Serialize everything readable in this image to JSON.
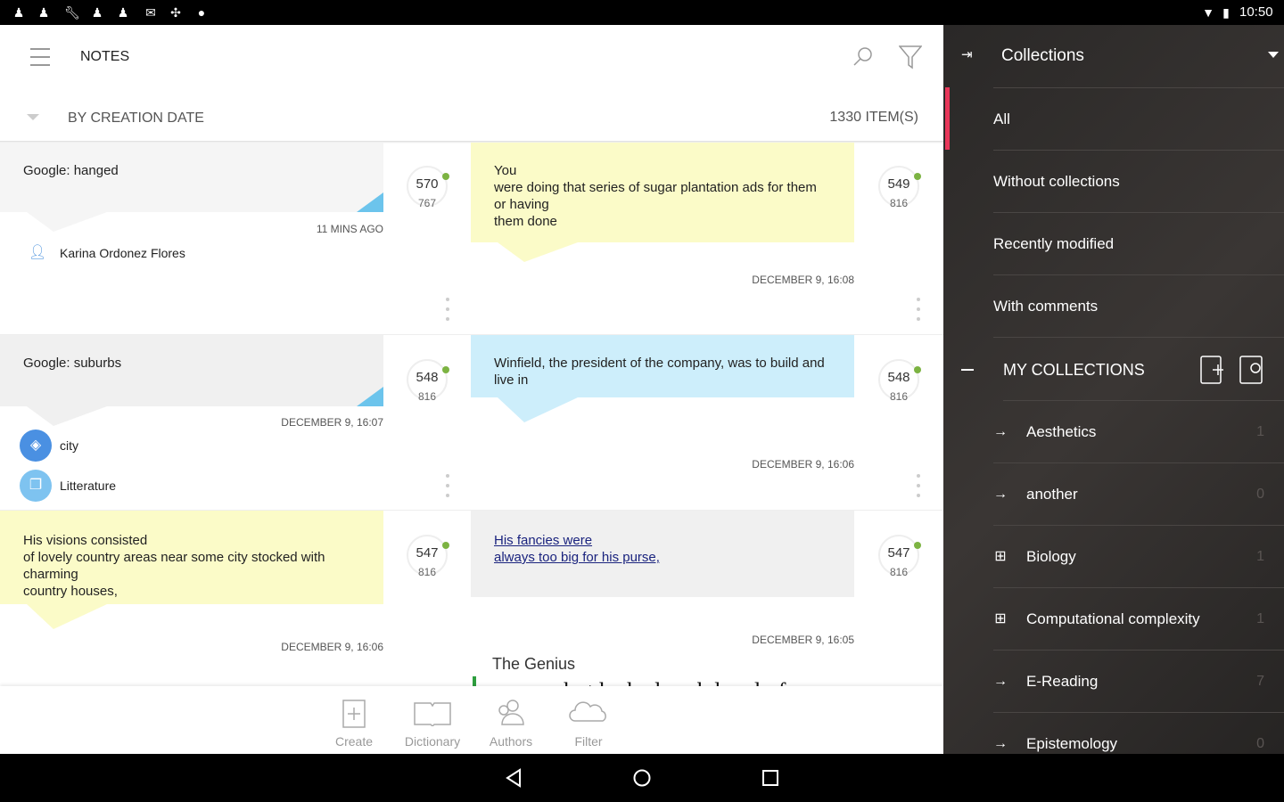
{
  "status_bar": {
    "time": "10:50"
  },
  "header": {
    "title": "NOTES"
  },
  "sort": {
    "label": "BY CREATION DATE",
    "count": "1330 ITEM(S)"
  },
  "notes": [
    {
      "text": "Google: hanged",
      "time": "11 MINS AGO",
      "author": "Karina Ordonez Flores",
      "count_a": "570",
      "count_b": "767",
      "color": "#f5f5f5"
    },
    {
      "text": "You\nwere doing that series of sugar plantation ads for them or having\nthem done",
      "time": "DECEMBER 9, 16:08",
      "count_a": "549",
      "count_b": "816",
      "color": "#fbfbc8"
    },
    {
      "text": "Google: suburbs",
      "time": "DECEMBER 9, 16:07",
      "tags": [
        "city",
        "Litterature"
      ],
      "count_a": "548",
      "count_b": "816",
      "color": "#f0f0f0"
    },
    {
      "text": "Winfield, the president of the company, was to build and live in",
      "time": "DECEMBER 9, 16:06",
      "count_a": "548",
      "count_b": "816",
      "color": "#cdeefb"
    },
    {
      "text": "His visions consisted\nof lovely country areas near some city stocked with charming\ncountry houses,",
      "time": "DECEMBER 9, 16:06",
      "count_a": "547",
      "count_b": "816",
      "color": "#fbfbc8"
    },
    {
      "text": "His fancies were\nalways too big for his purse,",
      "time": "DECEMBER 9, 16:05",
      "book": "The Genius",
      "excerpt": "purse, but he had such lovely fan-",
      "count_a": "547",
      "count_b": "816",
      "color": "#f0f0f0"
    }
  ],
  "toolbar": {
    "create": "Create",
    "dictionary": "Dictionary",
    "authors": "Authors",
    "filter": "Filter"
  },
  "drawer": {
    "title": "Collections",
    "items": [
      "All",
      "Without collections",
      "Recently modified",
      "With comments"
    ],
    "my_collections": "MY COLLECTIONS",
    "collections": [
      {
        "name": "Aesthetics",
        "count": "1",
        "icon": "arrow"
      },
      {
        "name": "another",
        "count": "0",
        "icon": "arrow"
      },
      {
        "name": "Biology",
        "count": "1",
        "icon": "plus"
      },
      {
        "name": "Computational complexity",
        "count": "1",
        "icon": "plus"
      },
      {
        "name": "E-Reading",
        "count": "7",
        "icon": "arrow"
      },
      {
        "name": "Epistemology",
        "count": "0",
        "icon": "arrow"
      }
    ]
  },
  "colors": {
    "accent": "#e8375a",
    "dot": "#7cb342",
    "drawer_bg": "#2e2b2a"
  }
}
